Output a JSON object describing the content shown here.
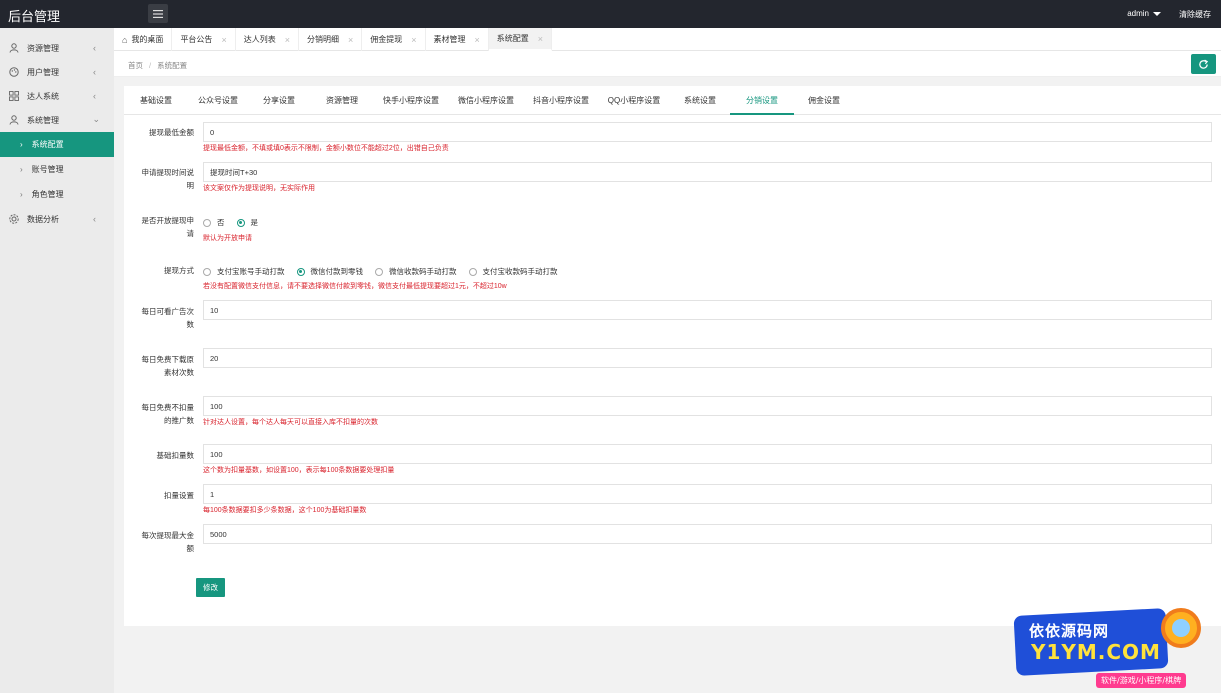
{
  "topbar": {
    "logo": "后台管理",
    "user": "admin",
    "clear_cache": "清除缓存"
  },
  "sidebar": {
    "items": [
      {
        "label": "资源管理",
        "icon": "user-icon"
      },
      {
        "label": "用户管理",
        "icon": "palette-icon"
      },
      {
        "label": "达人系统",
        "icon": "grid-icon"
      },
      {
        "label": "系统管理",
        "icon": "user-icon"
      },
      {
        "label": "数据分析",
        "icon": "gear-icon"
      }
    ],
    "subitems": [
      {
        "label": "系统配置",
        "active": true
      },
      {
        "label": "账号管理",
        "active": false
      },
      {
        "label": "角色管理",
        "active": false
      }
    ]
  },
  "tabs": [
    {
      "label": "我的桌面"
    },
    {
      "label": "平台公告"
    },
    {
      "label": "达人列表"
    },
    {
      "label": "分销明细"
    },
    {
      "label": "佣金提现"
    },
    {
      "label": "素材管理"
    },
    {
      "label": "系统配置"
    }
  ],
  "breadcrumb": {
    "home": "首页",
    "current": "系统配置"
  },
  "config_tabs": [
    "基础设置",
    "公众号设置",
    "分享设置",
    "资源管理",
    "快手小程序设置",
    "微信小程序设置",
    "抖音小程序设置",
    "QQ小程序设置",
    "系统设置",
    "分销设置",
    "佣金设置"
  ],
  "form": {
    "min_withdraw": {
      "label": "提现最低金额",
      "value": "0",
      "hint": "提现最低金额，不填或填0表示不限制，金额小数位不能超过2位，出错自己负责"
    },
    "withdraw_time": {
      "label": "申请提现时间说明",
      "value": "提现时间T+30",
      "hint": "该文案仅作为提现说明，无实际作用"
    },
    "open_withdraw": {
      "label": "是否开放提现申请",
      "options": [
        "否",
        "是"
      ],
      "selected": "是",
      "hint": "默认为开放申请"
    },
    "withdraw_method": {
      "label": "提现方式",
      "options": [
        "支付宝账号手动打款",
        "微信付款到零钱",
        "微信收款码手动打款",
        "支付宝收款码手动打款"
      ],
      "selected": "微信付款到零钱",
      "hint": "若没有配置微信支付信息，请不要选择微信付款到零钱，微信支付最低提现要超过1元，不超过10w"
    },
    "daily_ads": {
      "label": "每日可看广告次数",
      "value": "10"
    },
    "daily_free_downloads": {
      "label": "每日免费下载原素材次数",
      "value": "20"
    },
    "daily_free_no_deduct": {
      "label": "每日免费不扣量的推广数",
      "value": "100",
      "hint": "针对达人设置，每个达人每天可以直接入库不扣量的次数"
    },
    "base_deduct": {
      "label": "基础扣量数",
      "value": "100",
      "hint": "这个数为扣量基数，如设置100，表示每100条数据要处理扣量"
    },
    "deduct_setting": {
      "label": "扣量设置",
      "value": "1",
      "hint": "每100条数据要扣多少条数据，这个100为基础扣量数"
    },
    "max_withdraw": {
      "label": "每次提现最大金额",
      "value": "5000"
    },
    "submit": "修改"
  },
  "watermark": {
    "line1": "依依源码网",
    "line2": "Y1YM.COM",
    "line3": "软件/游戏/小程序/棋牌"
  }
}
